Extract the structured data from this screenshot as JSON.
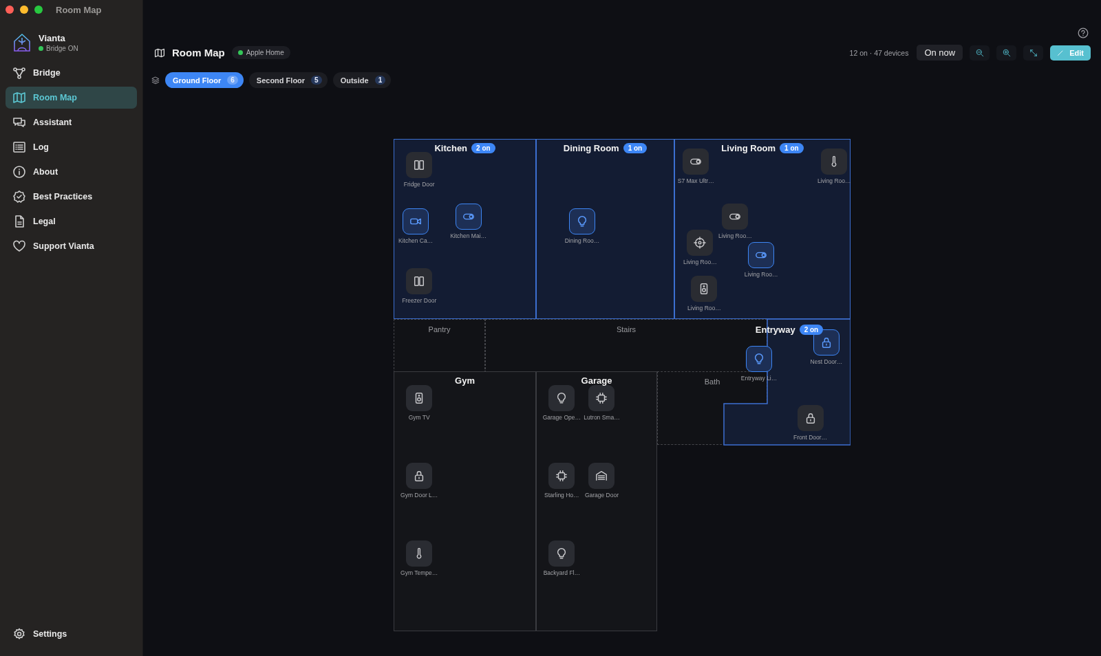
{
  "window": {
    "title": "Room Map"
  },
  "sidebar": {
    "brand": {
      "name": "Vianta",
      "status": "Bridge ON"
    },
    "items": [
      {
        "label": "Bridge",
        "selected": false
      },
      {
        "label": "Room Map",
        "selected": true
      },
      {
        "label": "Assistant",
        "selected": false
      },
      {
        "label": "Log",
        "selected": false
      },
      {
        "label": "About",
        "selected": false
      },
      {
        "label": "Best Practices",
        "selected": false
      },
      {
        "label": "Legal",
        "selected": false
      },
      {
        "label": "Support Vianta",
        "selected": false
      }
    ],
    "footer_item": {
      "label": "Settings"
    }
  },
  "header": {
    "title": "Room Map",
    "source": "Apple Home",
    "summary": "12 on · 47 devices",
    "on_now_button": "On now",
    "edit_button": "Edit"
  },
  "floors": [
    {
      "label": "Ground Floor",
      "count": "6",
      "selected": true
    },
    {
      "label": "Second Floor",
      "count": "5",
      "selected": false
    },
    {
      "label": "Outside",
      "count": "1",
      "selected": false
    }
  ],
  "map": {
    "rooms": [
      {
        "name": "Kitchen",
        "kind": "room",
        "highlighted": true,
        "badge": "2 on",
        "devices": [
          {
            "name": "Fridge Door",
            "on": false
          },
          {
            "name": "Kitchen Ca…",
            "on": true
          },
          {
            "name": "Kitchen Mai…",
            "on": true
          },
          {
            "name": "Freezer Door",
            "on": false
          }
        ]
      },
      {
        "name": "Dining Room",
        "kind": "room",
        "highlighted": true,
        "badge": "1 on",
        "devices": [
          {
            "name": "Dining Roo…",
            "on": true
          }
        ]
      },
      {
        "name": "Living Room",
        "kind": "room",
        "highlighted": true,
        "badge": "1 on",
        "devices": [
          {
            "name": "S7 Max Ultr…",
            "on": false
          },
          {
            "name": "Living Roo…",
            "on": false
          },
          {
            "name": "Living Roo…",
            "on": false
          },
          {
            "name": "Living Roo…",
            "on": false
          },
          {
            "name": "Living Roo…",
            "on": true
          },
          {
            "name": "Living Roo…",
            "on": false
          }
        ]
      },
      {
        "name": "Pantry",
        "kind": "zone",
        "highlighted": false
      },
      {
        "name": "Stairs",
        "kind": "zone",
        "highlighted": false
      },
      {
        "name": "Entryway",
        "kind": "room",
        "highlighted": true,
        "badge": "2 on",
        "devices": [
          {
            "name": "Entryway Li…",
            "on": true
          },
          {
            "name": "Nest Door…",
            "on": true
          },
          {
            "name": "Front Door…",
            "on": false
          }
        ]
      },
      {
        "name": "Gym",
        "kind": "room",
        "highlighted": false,
        "devices": [
          {
            "name": "Gym TV",
            "on": false
          },
          {
            "name": "Gym Door L…",
            "on": false
          },
          {
            "name": "Gym Tempe…",
            "on": false
          }
        ]
      },
      {
        "name": "Garage",
        "kind": "room",
        "highlighted": false,
        "devices": [
          {
            "name": "Garage Ope…",
            "on": false
          },
          {
            "name": "Lutron Sma…",
            "on": false
          },
          {
            "name": "Starling Ho…",
            "on": false
          },
          {
            "name": "Garage Door",
            "on": false
          },
          {
            "name": "Backyard Fl…",
            "on": false
          }
        ]
      },
      {
        "name": "Bath",
        "kind": "zone",
        "highlighted": false
      }
    ]
  }
}
